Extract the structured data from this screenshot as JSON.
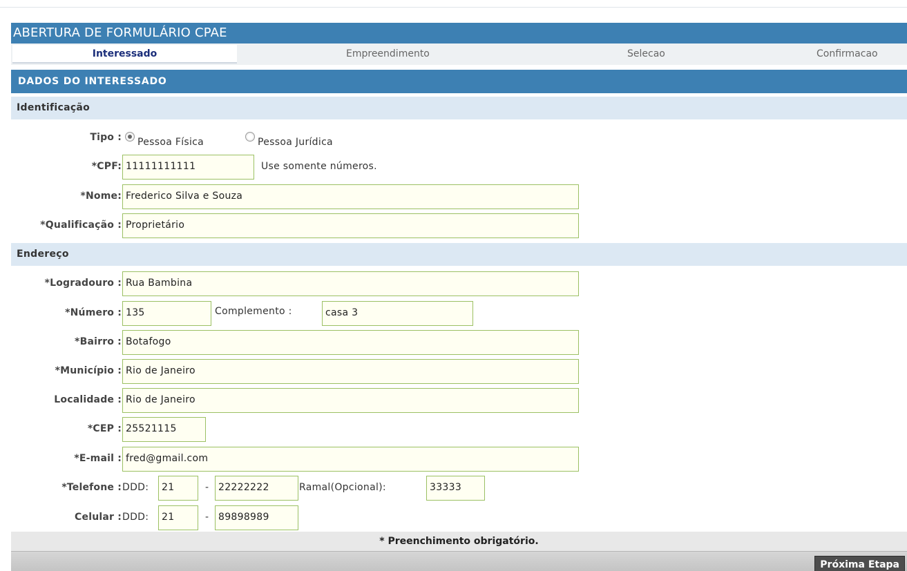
{
  "form_title": "ABERTURA DE FORMULÁRIO CPAE",
  "tabs": [
    {
      "label": "Interessado",
      "active": true
    },
    {
      "label": "Empreendimento",
      "active": false
    },
    {
      "label": "Selecao",
      "active": false
    },
    {
      "label": "Confirmacao",
      "active": false
    }
  ],
  "section_header": "DADOS DO INTERESSADO",
  "identificacao": {
    "title": "Identificação",
    "tipo_label": "Tipo :",
    "tipo_options": [
      {
        "label": "Pessoa Física",
        "selected": true
      },
      {
        "label": "Pessoa Jurídica",
        "selected": false
      }
    ],
    "cpf_label": "*CPF:",
    "cpf_value": "11111111111",
    "cpf_hint": "Use somente números.",
    "nome_label": "*Nome:",
    "nome_value": "Frederico Silva e Souza",
    "qualificacao_label": "*Qualificação :",
    "qualificacao_value": "Proprietário"
  },
  "endereco": {
    "title": "Endereço",
    "logradouro_label": "*Logradouro :",
    "logradouro_value": "Rua Bambina",
    "numero_label": "*Número :",
    "numero_value": "135",
    "complemento_label": "Complemento :",
    "complemento_value": "casa 3",
    "bairro_label": "*Bairro :",
    "bairro_value": "Botafogo",
    "municipio_label": "*Município :",
    "municipio_value": "Rio de Janeiro",
    "localidade_label": "Localidade :",
    "localidade_value": "Rio de Janeiro",
    "cep_label": "*CEP :",
    "cep_value": "25521115",
    "email_label": "*E-mail :",
    "email_value": "fred@gmail.com",
    "telefone_label": "*Telefone :",
    "telefone_ddd_label": "DDD:",
    "telefone_ddd": "21",
    "telefone_dash": "-",
    "telefone_numero": "22222222",
    "ramal_label": "Ramal(Opcional):",
    "ramal_value": "33333",
    "celular_label": "Celular :",
    "celular_ddd_label": "DDD:",
    "celular_ddd": "21",
    "celular_dash": "-",
    "celular_numero": "89898989"
  },
  "footer": {
    "required_note": "* Preenchimento obrigatório.",
    "next_button": "Próxima Etapa"
  },
  "colors": {
    "header_blue": "#3d80b3",
    "subsection_blue": "#dce8f3",
    "field_border": "#9bc063",
    "field_bg": "#fffff2"
  }
}
